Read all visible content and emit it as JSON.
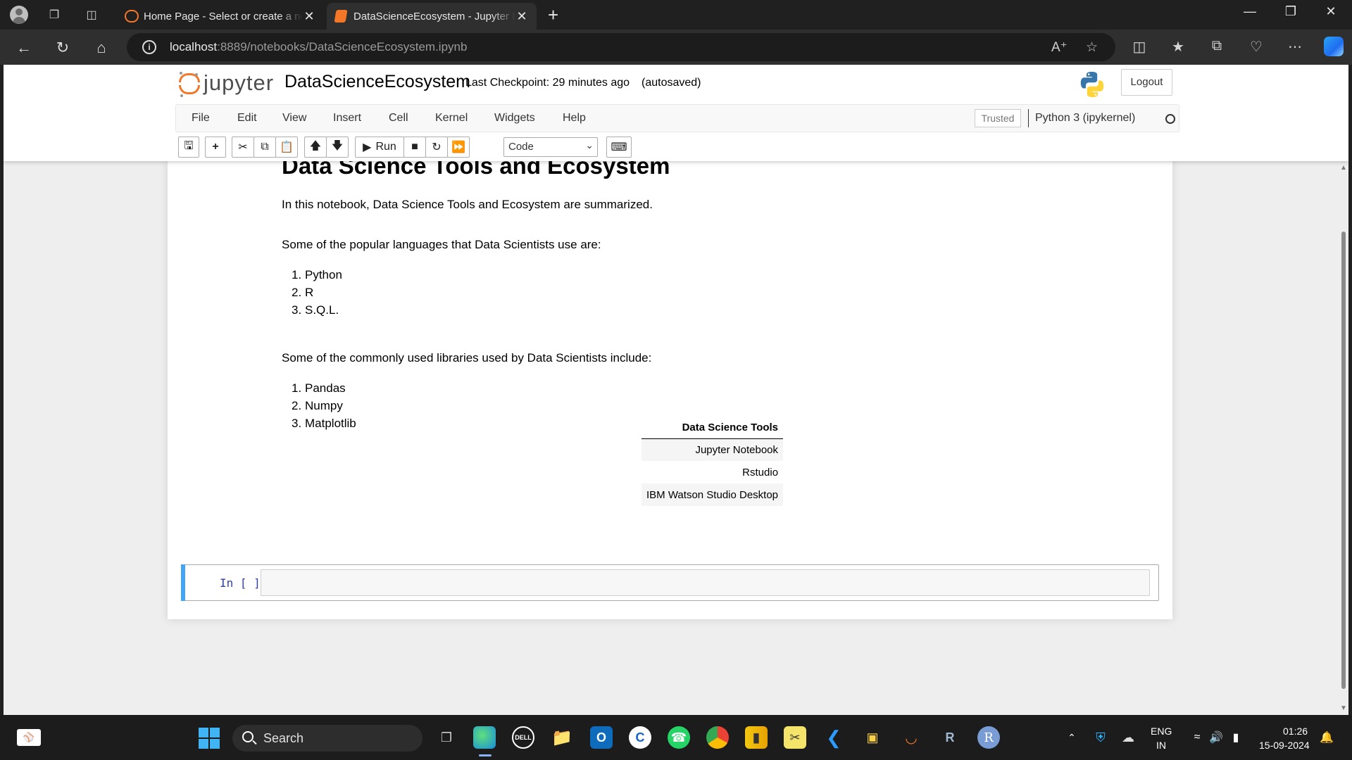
{
  "browser": {
    "tabs": [
      {
        "title": "Home Page - Select or create a notebook",
        "active": false
      },
      {
        "title": "DataScienceEcosystem - Jupyter Notebook",
        "active": true
      }
    ],
    "url_host": "localhost",
    "url_rest": ":8889/notebooks/DataScienceEcosystem.ipynb"
  },
  "jupyter": {
    "logo_text": "jupyter",
    "notebook_name": "DataScienceEcosystem",
    "checkpoint": "Last Checkpoint: 29 minutes ago",
    "autosave": "(autosaved)",
    "logout": "Logout",
    "menu": [
      "File",
      "Edit",
      "View",
      "Insert",
      "Cell",
      "Kernel",
      "Widgets",
      "Help"
    ],
    "trusted": "Trusted",
    "kernel": "Python 3 (ipykernel)",
    "toolbar": {
      "run": "Run",
      "cell_type": "Code"
    }
  },
  "content": {
    "heading": "Data Science Tools and Ecosystem",
    "intro": "In this notebook, Data Science Tools and Ecosystem are summarized.",
    "languages_intro": "Some of the popular languages that Data Scientists use are:",
    "languages": [
      "Python",
      "R",
      "S.Q.L."
    ],
    "libraries_intro": "Some of the commonly used libraries used by Data Scientists include:",
    "libraries": [
      "Pandas",
      "Numpy",
      "Matplotlib"
    ],
    "table": {
      "header": "Data Science Tools",
      "rows": [
        "Jupyter Notebook",
        "Rstudio",
        "IBM Watson Studio Desktop"
      ]
    },
    "code_prompt": "In [ ]:"
  },
  "taskbar": {
    "search": "Search",
    "lang": "ENG",
    "region": "IN",
    "time": "01:26",
    "date": "15-09-2024"
  },
  "colors": {
    "jupyter_orange": "#f37726",
    "cell_edge": "#42a5f5",
    "prompt_blue": "#303f9f"
  }
}
